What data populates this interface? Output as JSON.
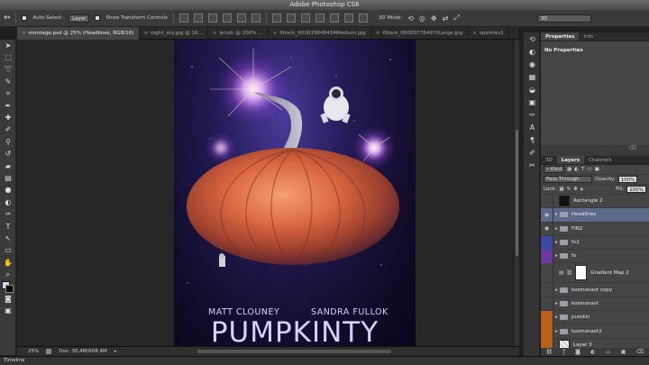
{
  "window": {
    "title": "Adobe Photoshop CS6"
  },
  "options_bar": {
    "auto_select_label": "Auto-Select:",
    "auto_select_value": "Layer",
    "transform_controls_label": "Show Transform Controls",
    "mode_3d_label": "3D Mode:",
    "workspace_value": "3D"
  },
  "document_tabs": [
    {
      "label": "montage.psd @ 25% (Headlines, RGB/16)",
      "active": true
    },
    {
      "label": "night_sky.jpg @ 16...",
      "active": false
    },
    {
      "label": "brush @ 200% ...",
      "active": false
    },
    {
      "label": "iStock_000019848434Medium.jpg",
      "active": false
    },
    {
      "label": "iStock_000007784970Large.jpg",
      "active": false
    },
    {
      "label": "sparkles1",
      "active": false
    }
  ],
  "artwork": {
    "author_left": "MATT CLOUNEY",
    "author_right": "SANDRA FULLOK",
    "title": "PUMPKINTY"
  },
  "status": {
    "zoom": "25%",
    "doc_info": "Doc: 30,4M/608,4M"
  },
  "timeline_label": "Timeline",
  "properties_panel": {
    "tabs": [
      "Properties",
      "Info"
    ],
    "active_tab": "Properties",
    "body_text": "No Properties"
  },
  "layers_panel": {
    "tabs": [
      "3D",
      "Layers",
      "Channels"
    ],
    "active_tab": "Layers",
    "filter_label": "Kind",
    "blend_mode": "Pass Through",
    "opacity_label": "Opacity:",
    "opacity_value": "100%",
    "lock_label": "Lock:",
    "fill_label": "Fill:",
    "fill_value": "100%",
    "layers": [
      {
        "name": "Rectangle 2",
        "visible": false,
        "type": "shape",
        "swatch": "#111111",
        "selected": false
      },
      {
        "name": "Headlines",
        "visible": true,
        "type": "group",
        "swatch": "",
        "selected": true
      },
      {
        "name": "FIN2",
        "visible": true,
        "type": "group",
        "swatch": "",
        "selected": false
      },
      {
        "name": "fx2",
        "visible": false,
        "type": "group",
        "swatch": "#3b4aa0",
        "selected": false
      },
      {
        "name": "fx",
        "visible": false,
        "type": "group",
        "swatch": "#6a3aa0",
        "selected": false
      },
      {
        "name": "Gradient Map 2",
        "visible": false,
        "type": "adjustment",
        "swatch": "#ffffff",
        "selected": false
      },
      {
        "name": "kosmonavt copy",
        "visible": false,
        "type": "group",
        "swatch": "",
        "selected": false
      },
      {
        "name": "kosmonavt",
        "visible": false,
        "type": "group",
        "swatch": "",
        "selected": false
      },
      {
        "name": "pumkin",
        "visible": false,
        "type": "group",
        "swatch": "#b8601a",
        "selected": false
      },
      {
        "name": "kosmonavt2",
        "visible": false,
        "type": "group",
        "swatch": "#b8601a",
        "selected": false
      },
      {
        "name": "Layer 3",
        "visible": false,
        "type": "pixel",
        "swatch": "#b8601a",
        "selected": false
      }
    ]
  }
}
